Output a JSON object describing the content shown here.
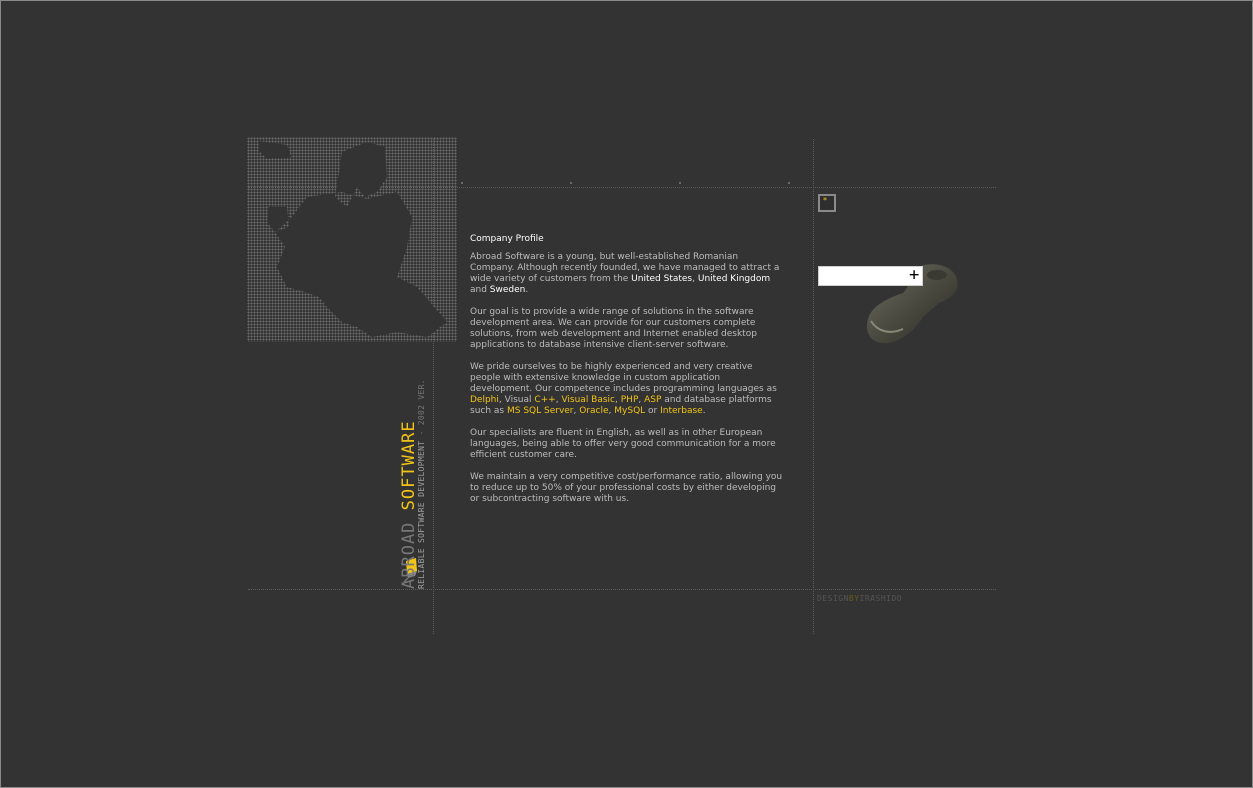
{
  "company": {
    "name_part1": "ABROAD",
    "name_part2": "SOFTWARE",
    "tagline": "RELIABLE SOFTWARE DEVELOPMENT",
    "version": "- 2002 VER."
  },
  "search": {
    "value": "",
    "plus_label": "+"
  },
  "small_button": {
    "label": "*"
  },
  "credit": {
    "part1": "DESIGN",
    "part2": "BY",
    "part3": "IRASHIDO"
  },
  "profile": {
    "title": "Company Profile",
    "p1": {
      "t1": "Abroad Software is a young, but well-established Romanian Company. Although recently founded, we have managed to attract a wide variety of customers from the ",
      "us": "United States",
      "c1": ", ",
      "uk": "United Kingdom",
      "and": " and ",
      "se": "Sweden",
      "end": "."
    },
    "p2": "Our goal is to provide a wide range of solutions in the software development area. We can provide for our customers complete solutions, from web development and Internet enabled desktop applications to database intensive client-server software.",
    "p3": {
      "t1": "We pride ourselves to be highly experienced and very creative people with extensive knowledge in custom application development. Our competence includes programming languages as ",
      "delphi": "Delphi",
      "t2": ", Visual ",
      "cpp": "C++",
      "t3": ", ",
      "vb": "Visual Basic",
      "t4": ", ",
      "php": "PHP",
      "t5": ", ",
      "asp": "ASP",
      "t6": " and database platforms such as ",
      "mssql": "MS SQL Server",
      "t7": ", ",
      "oracle": "Oracle",
      "t8": ", ",
      "mysql": "MySQL",
      "t9": " or ",
      "interbase": "Interbase",
      "t10": "."
    },
    "p4": "Our specialists are fluent in English, as well as in other European languages, being able to offer very good communication for a more efficient customer care.",
    "p5": "We maintain a very competitive cost/performance ratio, allowing you to reduce up to 50% of your professional costs by either developing or subcontracting software with us."
  },
  "colors": {
    "background": "#333333",
    "accent": "#f2c417",
    "text": "#bdbdbd",
    "highlight": "#ffffff"
  }
}
